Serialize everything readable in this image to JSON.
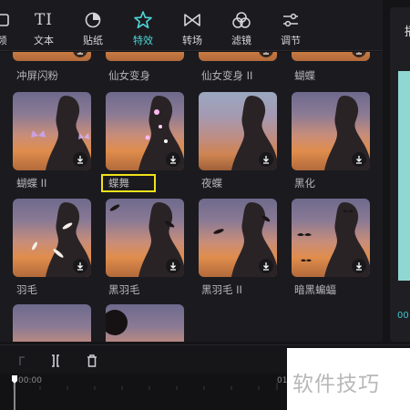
{
  "toolbar": {
    "items": [
      {
        "label": "频",
        "icon": "media-icon"
      },
      {
        "label": "文本",
        "icon": "text-icon"
      },
      {
        "label": "贴纸",
        "icon": "sticker-icon"
      },
      {
        "label": "特效",
        "icon": "effects-star-icon",
        "active": true
      },
      {
        "label": "转场",
        "icon": "transition-icon"
      },
      {
        "label": "滤镜",
        "icon": "filter-icon"
      },
      {
        "label": "调节",
        "icon": "adjust-icon"
      }
    ],
    "text_icon_glyph": "TI"
  },
  "right_panel": {
    "tab_char": "播",
    "time": "00"
  },
  "effects": {
    "top_row_partial": [
      "冲屏闪粉",
      "仙女变身",
      "仙女变身 II",
      "蝴蝶"
    ],
    "rows": [
      [
        "蝴蝶 II",
        "蝶舞",
        "夜蝶",
        "黑化"
      ],
      [
        "羽毛",
        "黑羽毛",
        "黑羽毛 II",
        "暗黑蝙蝠"
      ]
    ],
    "highlighted": "蝶舞"
  },
  "timeline": {
    "start_time": "00:00",
    "end_time_partial": "01"
  },
  "watermark": "软件技巧",
  "colors": {
    "accent": "#4fd6d8",
    "highlight_box": "#f0e21a",
    "panel_bg": "#1b1b1f"
  }
}
